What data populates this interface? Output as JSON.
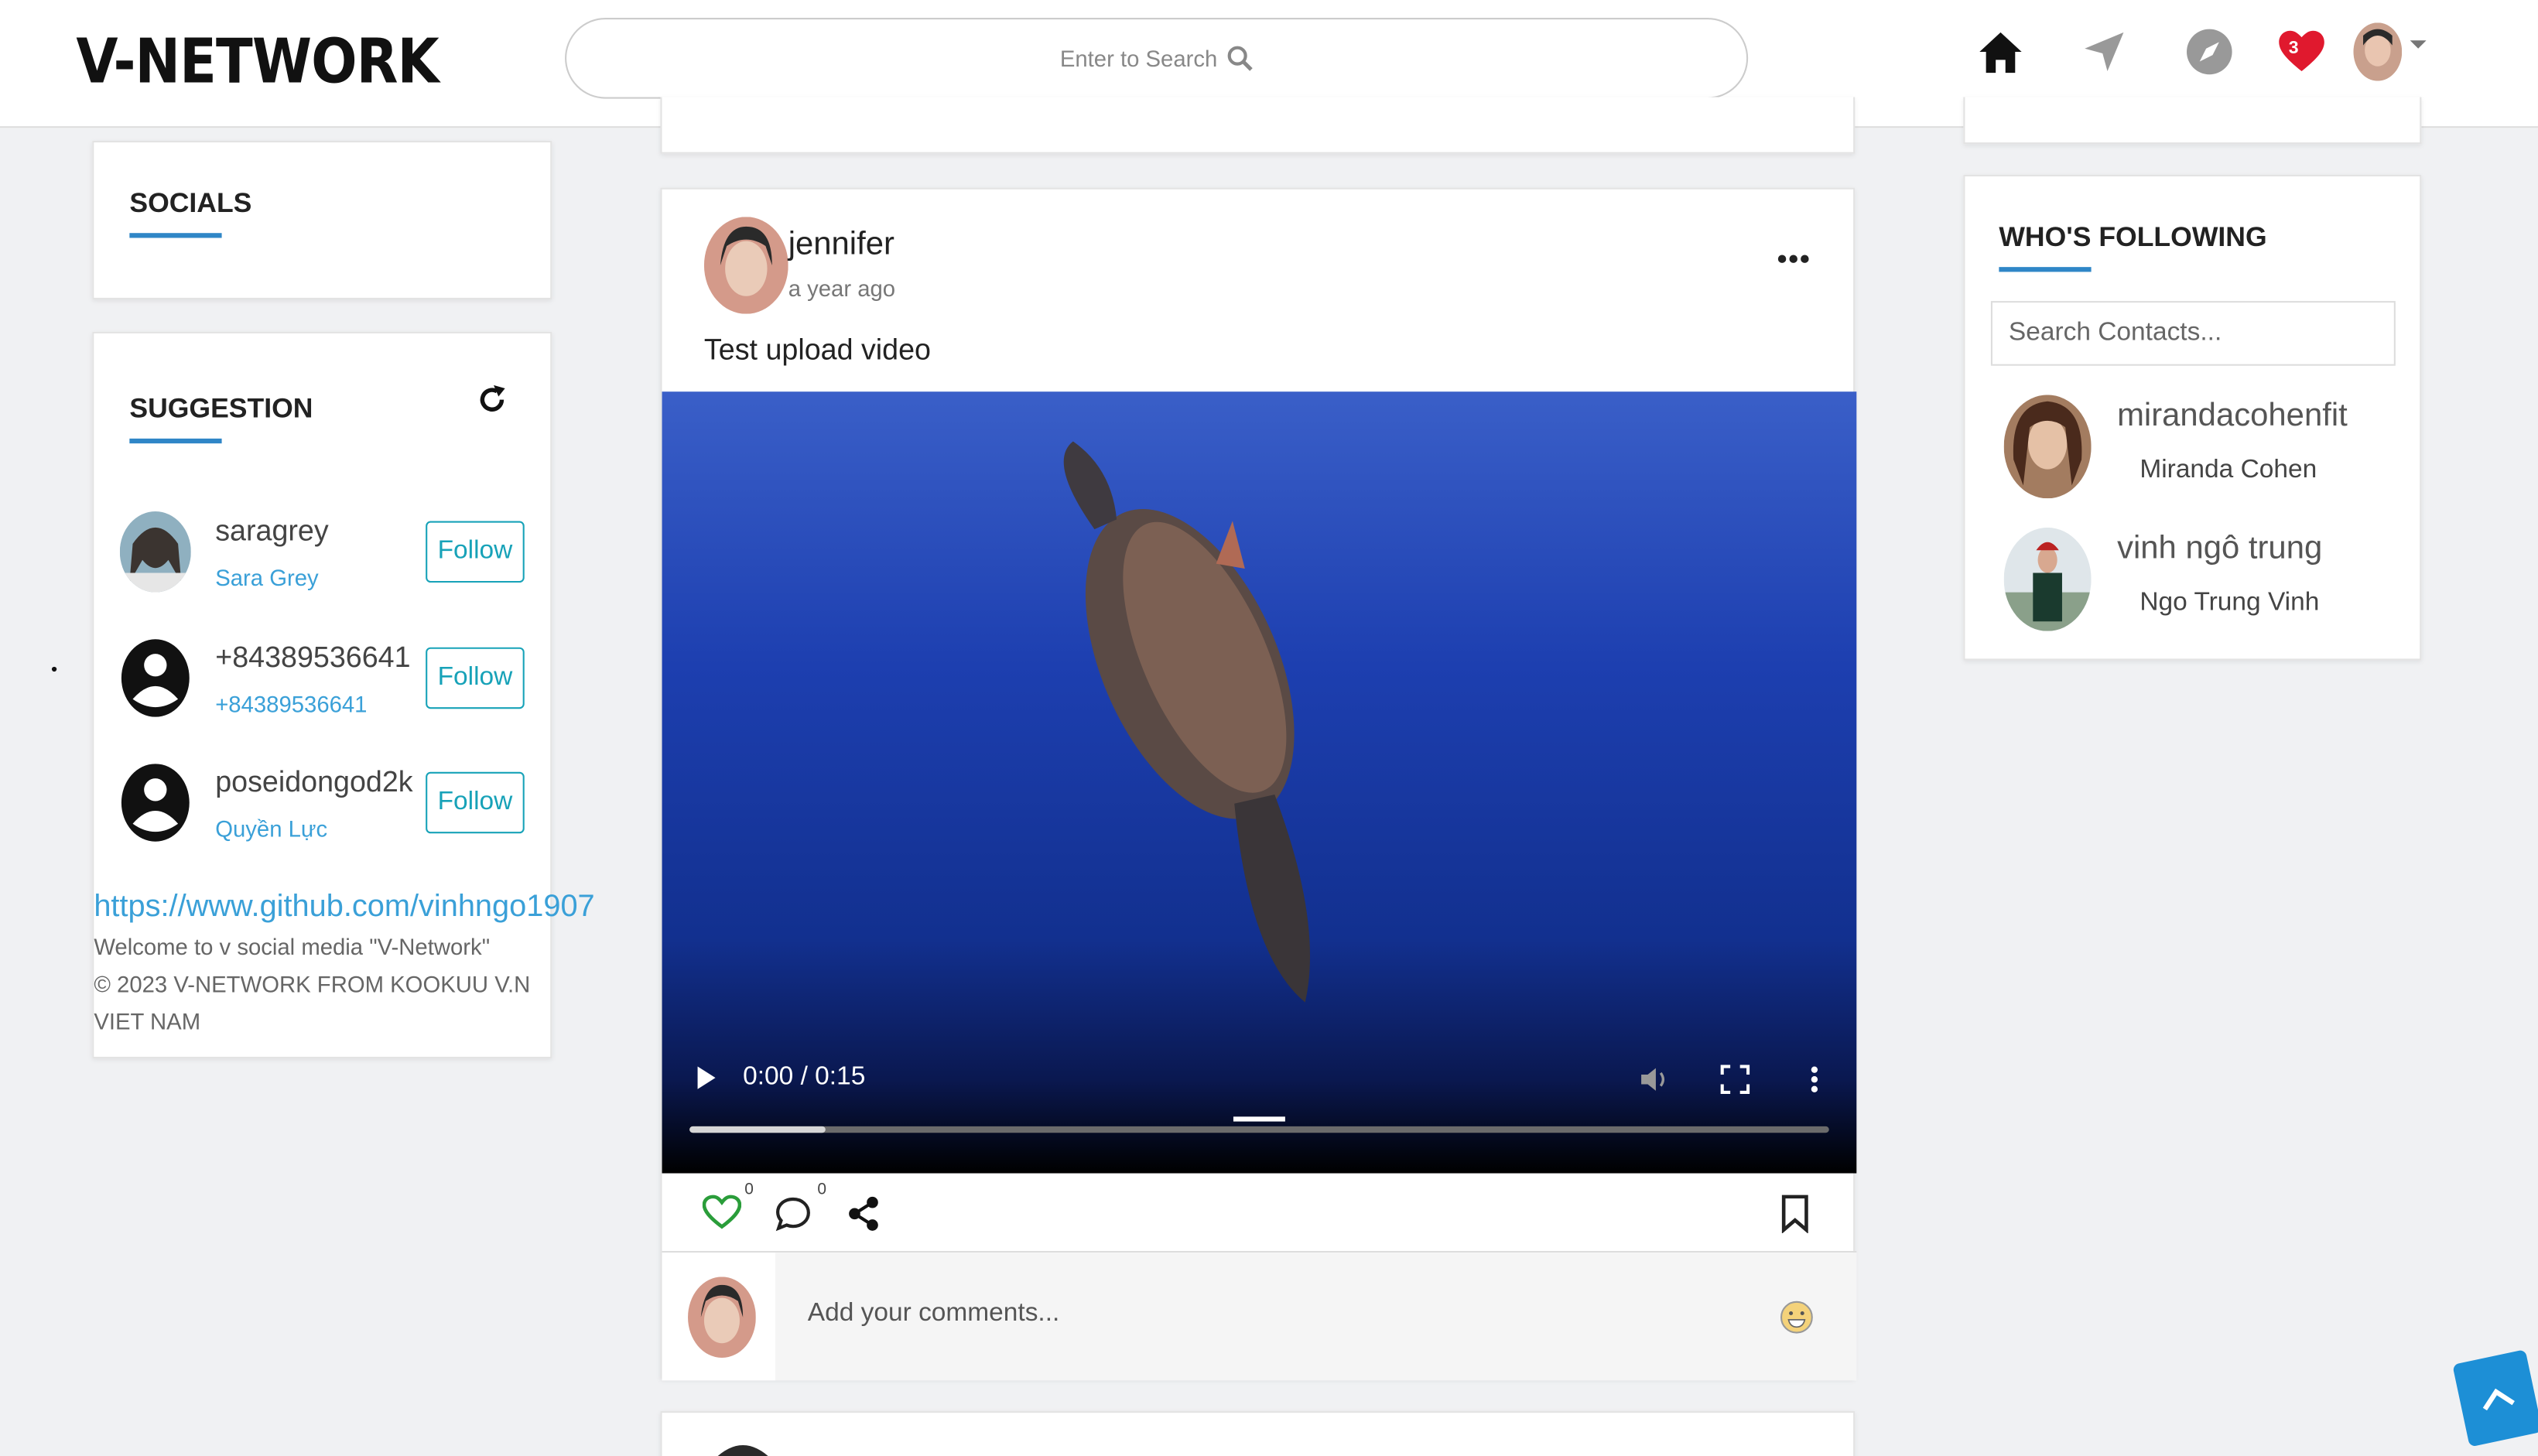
{
  "header": {
    "logo": "V-NETWORK",
    "search_placeholder": "Enter to Search",
    "notification_count": "3"
  },
  "socials": {
    "title": "SOCIALS"
  },
  "suggestion": {
    "title": "SUGGESTION",
    "items": [
      {
        "username": "saragrey",
        "display": "Sara Grey",
        "button": "Follow"
      },
      {
        "username": "+84389536641",
        "display": "+84389536641",
        "button": "Follow"
      },
      {
        "username": "poseidongod2k",
        "display": "Quyền Lực",
        "button": "Follow"
      }
    ],
    "link": "https://www.github.com/vinhngo1907",
    "welcome": "Welcome to v social media \"V-Network\"",
    "copyright": "© 2023 V-NETWORK FROM KOOKUU V.N VIET NAM"
  },
  "post": {
    "author": "jennifer",
    "time": "a year ago",
    "caption": "Test upload video",
    "video_time": "0:00 / 0:15",
    "video_progress": 0.12,
    "likes": "0",
    "comments": "0",
    "comment_placeholder": "Add your comments..."
  },
  "following": {
    "title": "WHO'S FOLLOWING",
    "search_placeholder": "Search Contacts...",
    "items": [
      {
        "username": "mirandacohenfit",
        "display": "Miranda Cohen"
      },
      {
        "username": "vinh ngô trung",
        "display": "Ngo Trung Vinh"
      }
    ]
  },
  "colors": {
    "accent": "#2f86c7",
    "follow": "#17a2b8",
    "like": "#2a9d3a",
    "badge": "#e0192e"
  }
}
